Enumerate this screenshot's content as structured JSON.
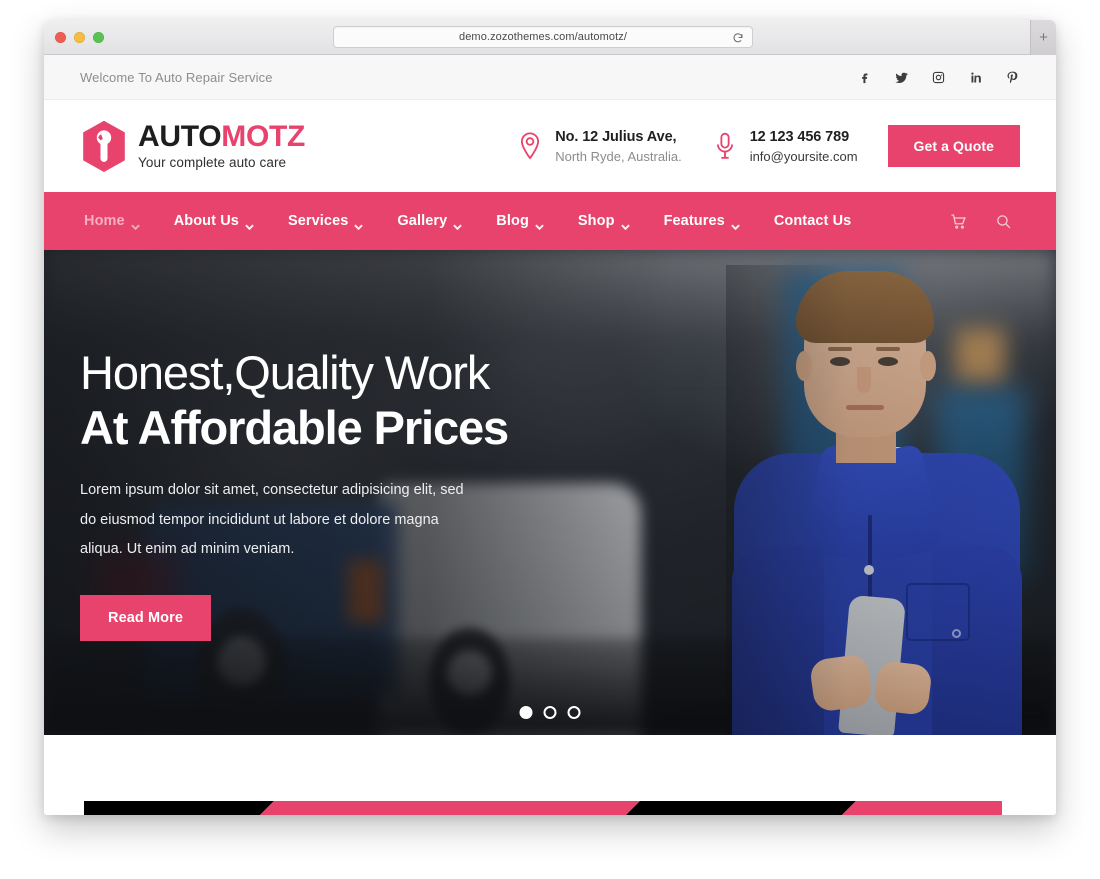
{
  "browser": {
    "url": "demo.zozothemes.com/automotz/",
    "reload_icon": "reload-icon",
    "new_tab_label": "+",
    "traffic_lights": [
      "close-red",
      "minimize-yellow",
      "zoom-green"
    ]
  },
  "topbar": {
    "welcome": "Welcome To Auto Repair Service",
    "social": [
      {
        "name": "facebook",
        "label": "f"
      },
      {
        "name": "twitter",
        "label": ""
      },
      {
        "name": "instagram",
        "label": ""
      },
      {
        "name": "linkedin",
        "label": "in"
      },
      {
        "name": "pinterest",
        "label": "P"
      }
    ]
  },
  "header": {
    "logo": {
      "part1": "AUTO",
      "part2": "MOTZ",
      "tagline": "Your complete auto care",
      "mark": "hexagon-wrench-icon"
    },
    "address": {
      "icon": "map-pin-icon",
      "line1": "No. 12 Julius Ave,",
      "line2": "North Ryde, Australia."
    },
    "contact": {
      "icon": "phone-mic-icon",
      "line1": "12 123 456 789",
      "line2": "info@yoursite.com"
    },
    "quote_button": "Get a Quote"
  },
  "nav": {
    "items": [
      {
        "label": "Home",
        "caret": true,
        "active": true
      },
      {
        "label": "About Us",
        "caret": true,
        "active": false
      },
      {
        "label": "Services",
        "caret": true,
        "active": false
      },
      {
        "label": "Gallery",
        "caret": true,
        "active": false
      },
      {
        "label": "Blog",
        "caret": true,
        "active": false
      },
      {
        "label": "Shop",
        "caret": true,
        "active": false
      },
      {
        "label": "Features",
        "caret": true,
        "active": false
      },
      {
        "label": "Contact Us",
        "caret": false,
        "active": false
      }
    ],
    "tools": [
      {
        "name": "cart-icon"
      },
      {
        "name": "search-icon"
      }
    ]
  },
  "hero": {
    "heading_line1": "Honest,Quality Work",
    "heading_line2": "At Affordable Prices",
    "paragraph": "Lorem ipsum dolor sit amet, consectetur adipisicing elit, sed do eiusmod tempor incididunt ut labore et dolore magna aliqua. Ut enim ad minim veniam.",
    "cta": "Read More",
    "slides_total": 3,
    "active_slide": 1
  },
  "colors": {
    "brand_pink": "#e8436c",
    "nav_bg": "#e8436c",
    "topbar_bg": "#f7f7f7",
    "logo_dark": "#1e1e1e",
    "stripe_black": "#000000"
  }
}
